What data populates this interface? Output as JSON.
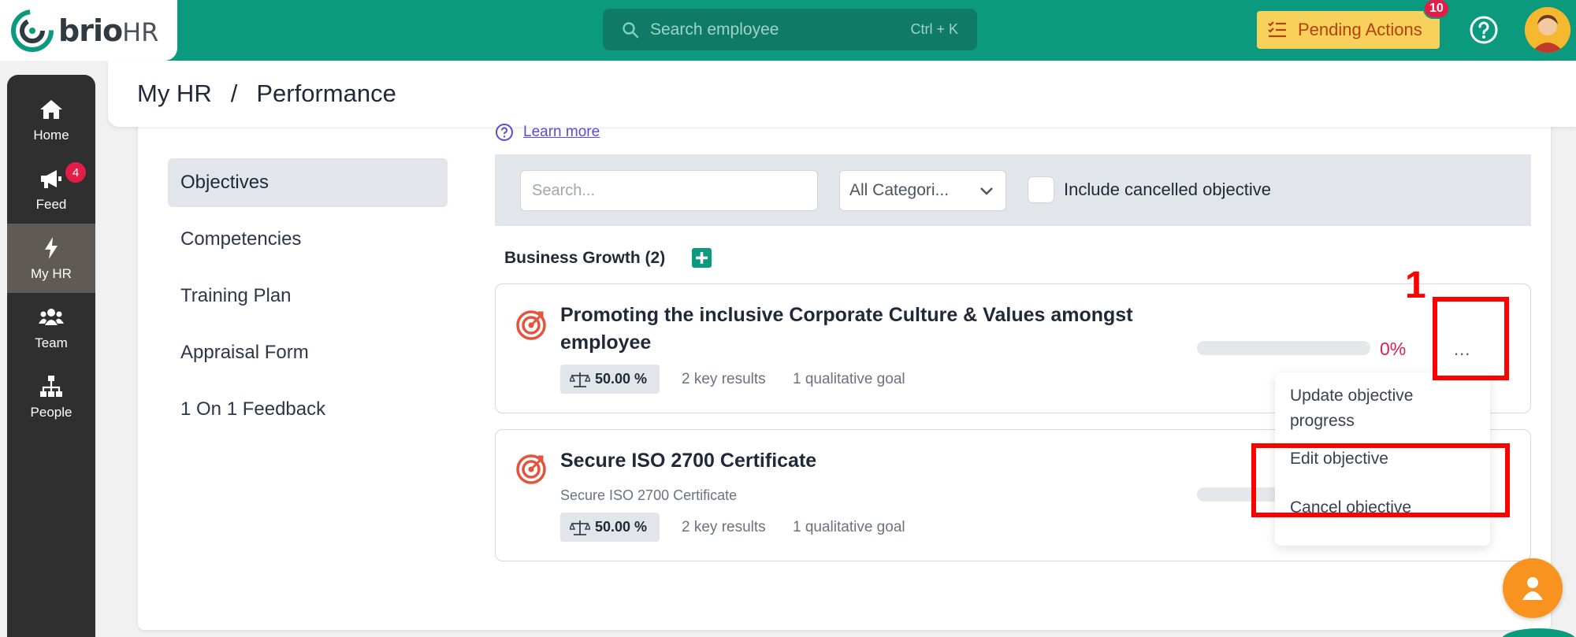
{
  "brand": {
    "name": "brio",
    "suffix": "HR"
  },
  "topbar": {
    "search_placeholder": "Search employee",
    "search_shortcut": "Ctrl + K",
    "pending_label": "Pending Actions",
    "pending_count": "10"
  },
  "sidebar": {
    "items": [
      {
        "label": "Home",
        "icon": "home-icon"
      },
      {
        "label": "Feed",
        "icon": "megaphone-icon",
        "badge": "4"
      },
      {
        "label": "My HR",
        "icon": "bolt-icon",
        "active": true
      },
      {
        "label": "Team",
        "icon": "team-icon"
      },
      {
        "label": "People",
        "icon": "org-chart-icon"
      }
    ]
  },
  "breadcrumb": {
    "root": "My HR",
    "sep": "/",
    "current": "Performance"
  },
  "learn_more": "Learn more",
  "subnav": [
    {
      "label": "Objectives",
      "active": true
    },
    {
      "label": "Competencies"
    },
    {
      "label": "Training Plan"
    },
    {
      "label": "Appraisal Form"
    },
    {
      "label": "1 On 1 Feedback"
    }
  ],
  "filters": {
    "search_placeholder": "Search...",
    "category_value": "All Categori...",
    "include_cancelled_label": "Include cancelled objective"
  },
  "group": {
    "title": "Business Growth (2)"
  },
  "objectives": [
    {
      "title_line1": "Promoting the inclusive Corporate Culture & Values amongst",
      "title_line2": "employee",
      "weight": "50.00 %",
      "key_results": "2 key results",
      "qualitative": "1 qualitative goal",
      "progress_value": 0,
      "progress_label": "0%",
      "more_label": "..."
    },
    {
      "title_line1": "Secure ISO 2700 Certificate",
      "subtitle": "Secure ISO 2700 Certificate",
      "weight": "50.00 %",
      "key_results": "2 key results",
      "qualitative": "1 qualitative goal"
    }
  ],
  "menu": {
    "items": [
      {
        "label_line1": "Update objective",
        "label_line2": "progress"
      },
      {
        "label_line1": "Edit objective"
      },
      {
        "label_line1": "Cancel objective"
      }
    ]
  },
  "annotation": {
    "step": "1"
  },
  "colors": {
    "brand_green": "#0b9a7d",
    "pending_bg": "#f7d15c",
    "badge_red": "#e11d48",
    "highlight_red": "#ff0000",
    "fab_orange": "#f7931e"
  }
}
